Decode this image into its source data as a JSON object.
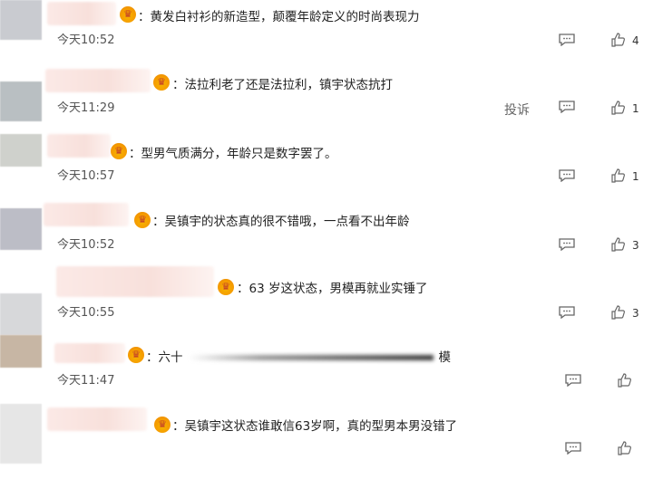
{
  "comments": [
    {
      "text": "：黄发白衬衫的新造型，颠覆年龄定义的时尚表现力",
      "time": "今天10:52",
      "likes": "4",
      "avatar_color": "#c9cbd0"
    },
    {
      "text": "：法拉利老了还是法拉利，镇宇状态抗打",
      "time": "今天11:29",
      "likes": "1",
      "report": "投诉",
      "avatar_color": "#b9bfc2"
    },
    {
      "text": "：型男气质满分，年龄只是数字罢了。",
      "time": "今天10:57",
      "likes": "1",
      "avatar_color": "#cfd1cc"
    },
    {
      "text": "：吴镇宇的状态真的很不错哦，一点看不出年龄",
      "time": "今天10:52",
      "likes": "3",
      "avatar_color": "#bcbdc6"
    },
    {
      "text": "：63 岁这状态，男模再就业实锤了",
      "time": "今天10:55",
      "likes": "3",
      "avatar_color": "#d7d8da"
    },
    {
      "text_start": "：六十",
      "text_end": "模",
      "time": "今天11:47",
      "likes": "",
      "avatar_color": "#c7b6a4"
    },
    {
      "text": "：吴镇宇这状态谁敢信63岁啊，真的型男本男没错了",
      "time": "",
      "likes": "",
      "avatar_color": "#e6e6e6"
    }
  ],
  "icons": {
    "reply": "comment-icon",
    "like": "thumbs-up-icon",
    "badge": "vip-crown-icon"
  }
}
